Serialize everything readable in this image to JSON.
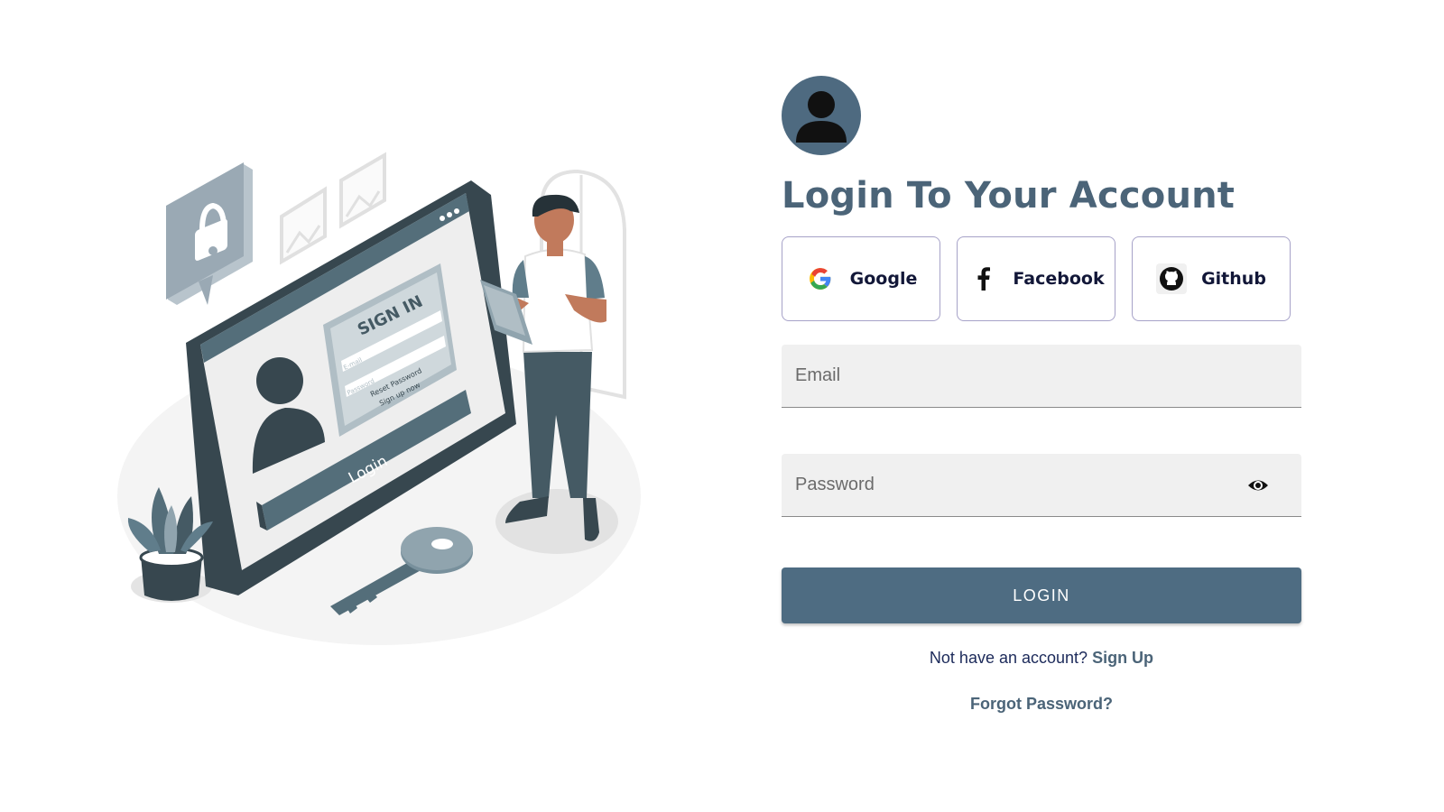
{
  "illustration": {
    "sign_in_title": "SIGN IN",
    "email_hint": "E-mail",
    "password_hint": "Password",
    "reset_link": "Reset Password",
    "signup_link": "Sign up now",
    "login_bar": "Login"
  },
  "login": {
    "avatar_icon": "user-avatar-icon",
    "title": "Login To Your Account",
    "social": [
      {
        "label": "Google",
        "icon": "google-icon"
      },
      {
        "label": "Facebook",
        "icon": "facebook-icon"
      },
      {
        "label": "Github",
        "icon": "github-icon"
      }
    ],
    "email_placeholder": "Email",
    "password_placeholder": "Password",
    "login_button": "LOGIN",
    "signup_prompt": "Not have an account?",
    "signup_link": "Sign Up",
    "forgot_link": "Forgot Password?"
  },
  "colors": {
    "accent": "#4e6c82",
    "title": "#4b6478",
    "social_border": "#a6a2c8",
    "field_bg": "#f0f0f0"
  }
}
